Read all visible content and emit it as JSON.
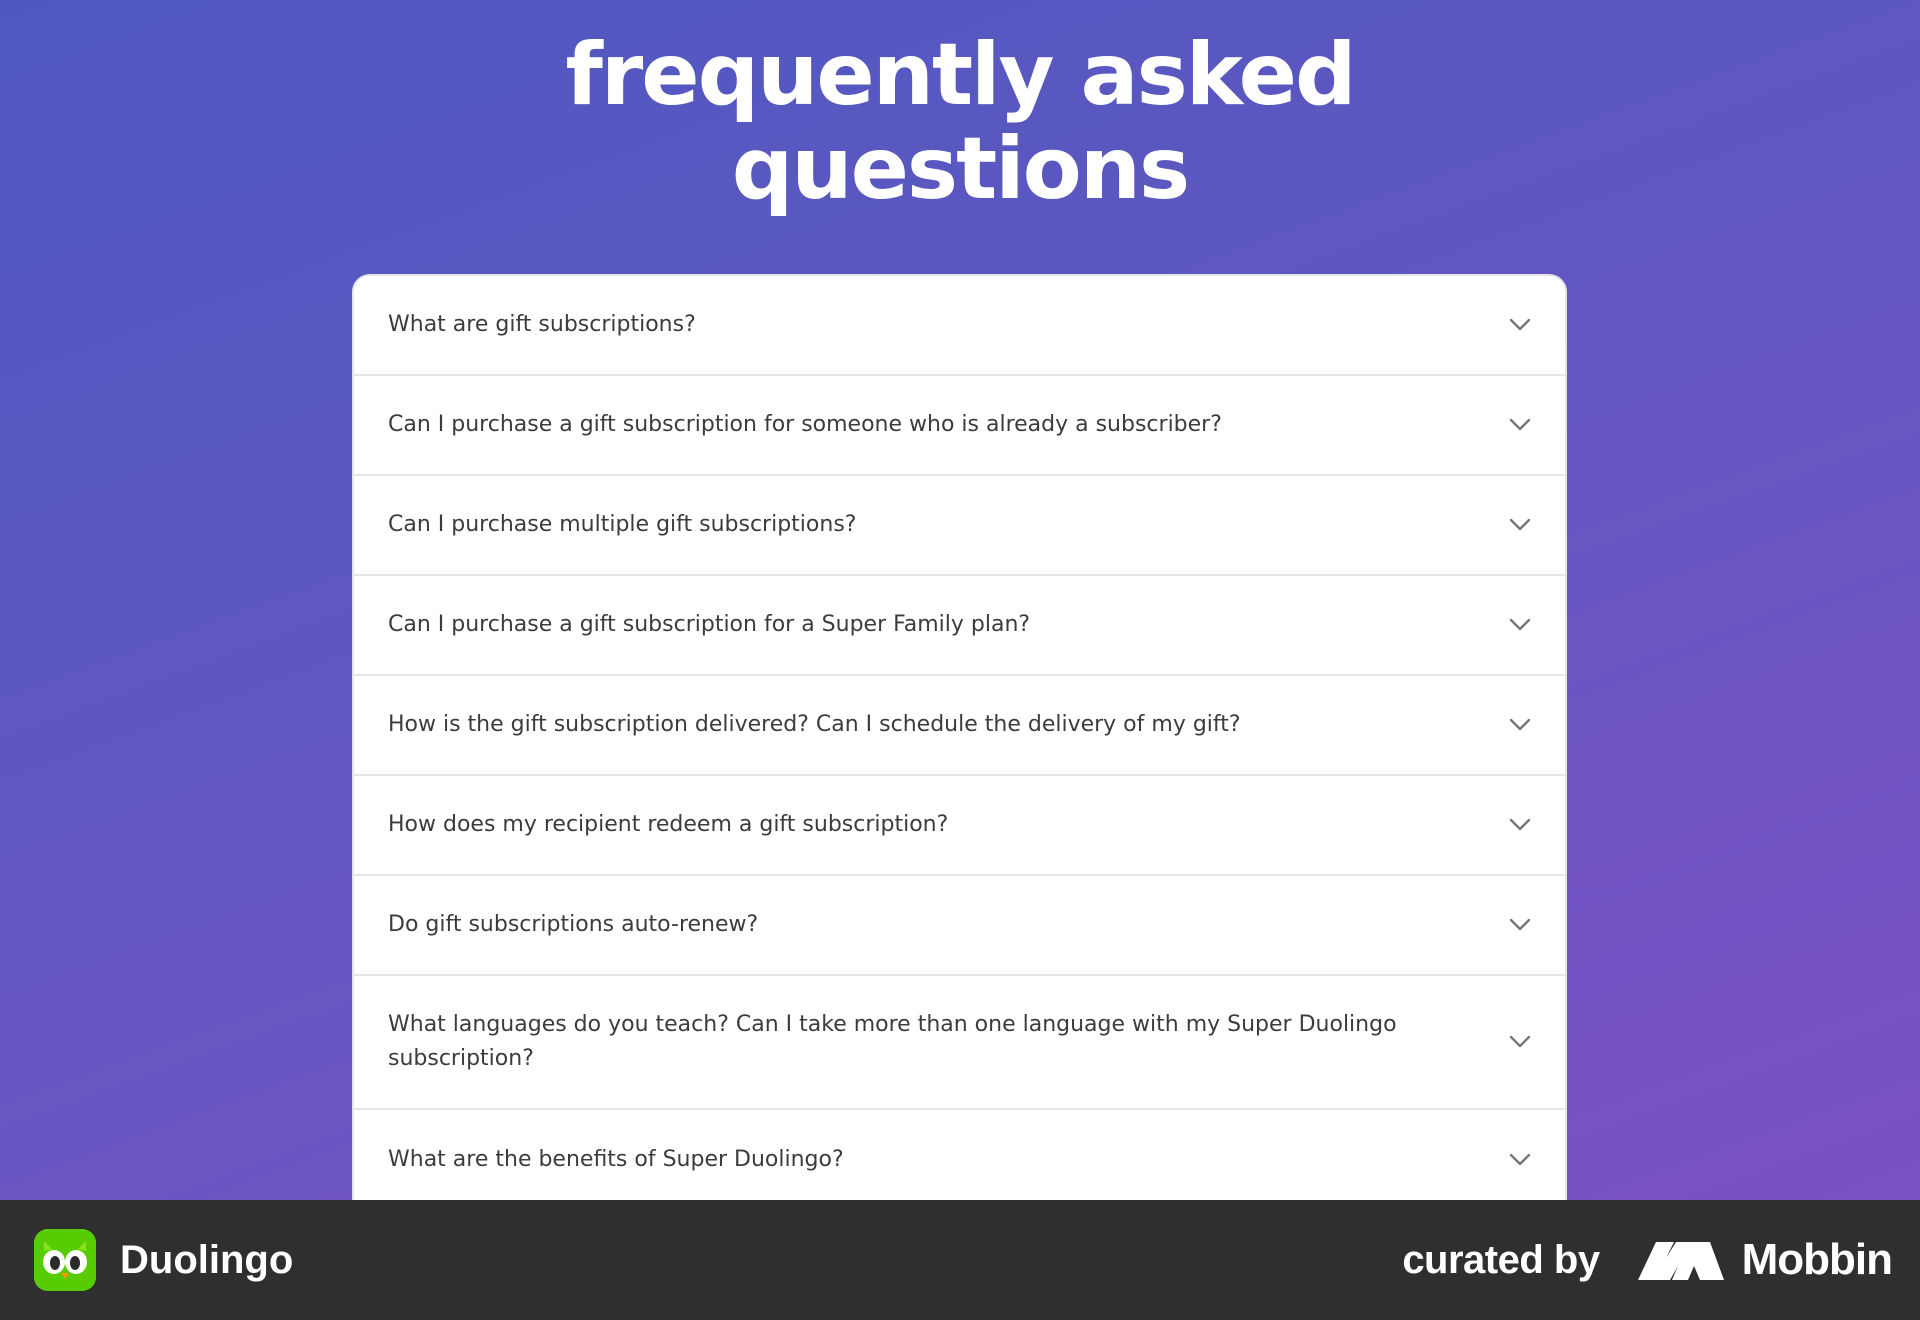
{
  "page": {
    "title_line1": "frequently asked",
    "title_line2": "questions"
  },
  "faq": {
    "items": [
      {
        "question": "What are gift subscriptions?",
        "icon": "chevron-down-icon"
      },
      {
        "question": "Can I purchase a gift subscription for someone who is already a subscriber?",
        "icon": "chevron-down-icon"
      },
      {
        "question": "Can I purchase multiple gift subscriptions?",
        "icon": "chevron-down-icon"
      },
      {
        "question": "Can I purchase a gift subscription for a Super Family plan?",
        "icon": "chevron-down-icon"
      },
      {
        "question": "How is the gift subscription delivered? Can I schedule the delivery of my gift?",
        "icon": "chevron-down-icon"
      },
      {
        "question": "How does my recipient redeem a gift subscription?",
        "icon": "chevron-down-icon"
      },
      {
        "question": "Do gift subscriptions auto-renew?",
        "icon": "chevron-down-icon"
      },
      {
        "question": "What languages do you teach? Can I take more than one language with my Super Duolingo subscription?",
        "icon": "chevron-down-icon"
      },
      {
        "question": "What are the benefits of Super Duolingo?",
        "icon": "chevron-down-icon"
      }
    ]
  },
  "footer": {
    "app_name": "Duolingo",
    "app_logo_icon": "duolingo-owl-icon",
    "curated_label": "curated by",
    "curator_name": "Mobbin",
    "curator_logo_icon": "mobbin-logo-icon"
  },
  "colors": {
    "background_gradient_start": "#4f58c2",
    "background_gradient_end": "#7d4fc2",
    "card": "#ffffff",
    "divider": "#e5e5e5",
    "question_text": "#3c3c3c",
    "chevron": "#777777",
    "footer": "#2f2f2f",
    "duolingo_green": "#58cc02"
  }
}
